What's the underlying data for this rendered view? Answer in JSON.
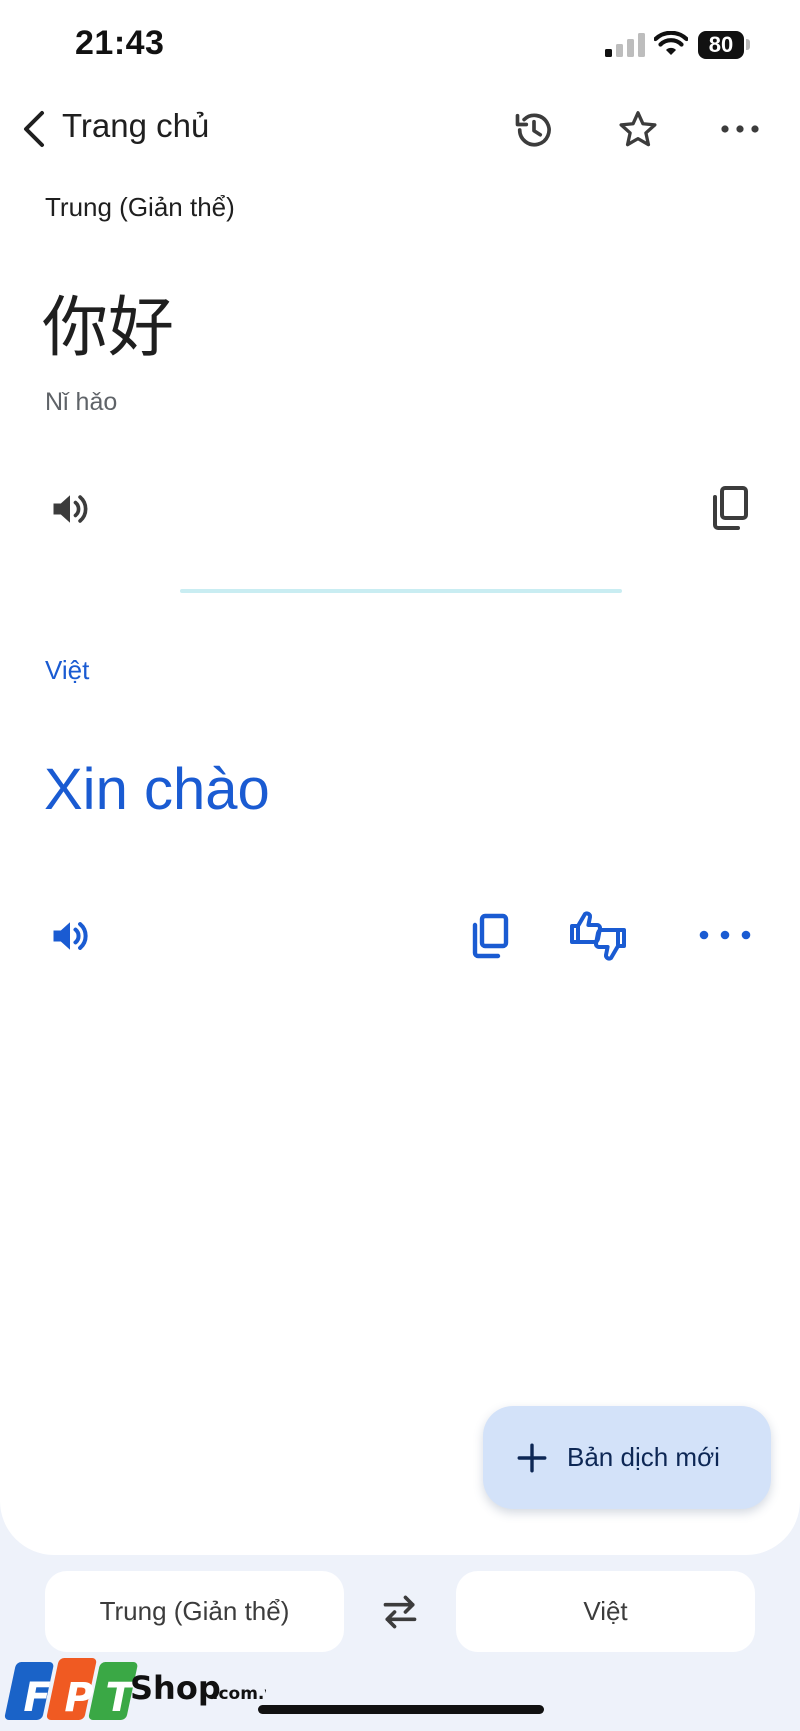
{
  "status_bar": {
    "time": "21:43",
    "battery": "80"
  },
  "top_bar": {
    "back_label": "Trang chủ",
    "icons": [
      "back-chevron-icon",
      "history-icon",
      "star-icon",
      "more-horizontal-icon"
    ]
  },
  "source": {
    "language": "Trung (Giản thể)",
    "text": "你好",
    "transliteration": "Nǐ hǎo",
    "icons": [
      "speaker-icon",
      "copy-icon"
    ]
  },
  "target": {
    "language": "Việt",
    "text": "Xin chào",
    "icons": [
      "speaker-icon",
      "copy-icon",
      "feedback-thumbs-icon",
      "more-horizontal-icon"
    ]
  },
  "fab": {
    "label": "Bản dịch mới",
    "icon": "plus-icon"
  },
  "language_bar": {
    "source_language": "Trung (Giản thể)",
    "target_language": "Việt",
    "swap_icon": "swap-icon"
  },
  "watermark": {
    "brand": "FPT",
    "text": "Shop",
    "suffix": ".com.vn"
  },
  "colors": {
    "accent": "#1a5bd2",
    "fab_background": "#d3e2f9",
    "page_background": "#eef2fa"
  }
}
